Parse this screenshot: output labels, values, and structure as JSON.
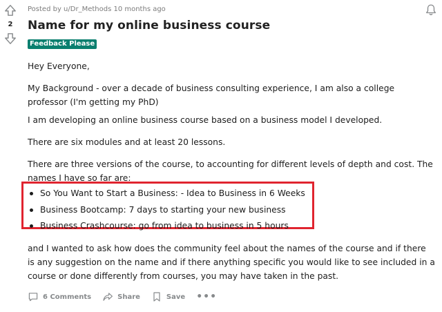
{
  "post": {
    "score": "2",
    "posted_by": "Posted by u/Dr_Methods 10 months ago",
    "title": "Name for my online business course",
    "flair": "Feedback Please",
    "body": {
      "greeting": "Hey Everyone,",
      "background": "My Background - over a decade of business consulting experience, I am also a college professor (I'm getting my PhD)",
      "developing": "I am developing an online business course based on a business model I developed.",
      "modules": "There are six modules and at least 20 lessons.",
      "versions": "There are three versions of the course, to accounting for different levels of depth and cost. The names I have so far are:",
      "course_names": [
        "So You Want to Start a Business: - Idea to Business in 6 Weeks",
        "Business Bootcamp: 7 days to starting your new business",
        "Business Crashcourse: go from idea to business in 5 hours"
      ],
      "closing": "and I wanted to ask how does the community feel about the names of the course and if there is any suggestion on the name and if there anything specific you would like to see included in a course or done differently from courses, you may have taken in the past."
    }
  },
  "actions": {
    "comments": "6 Comments",
    "share": "Share",
    "save": "Save",
    "more": "•••"
  },
  "icons": {
    "upvote": "upvote-arrow-icon",
    "downvote": "downvote-arrow-icon",
    "bell": "bell-icon",
    "comments": "comment-bubble-icon",
    "share": "share-arrow-icon",
    "save": "bookmark-icon"
  },
  "colors": {
    "flair_bg": "#0a7f6f",
    "highlight_border": "#e0242f",
    "meta_text": "#7c7c7c",
    "action_text": "#878a8c"
  }
}
